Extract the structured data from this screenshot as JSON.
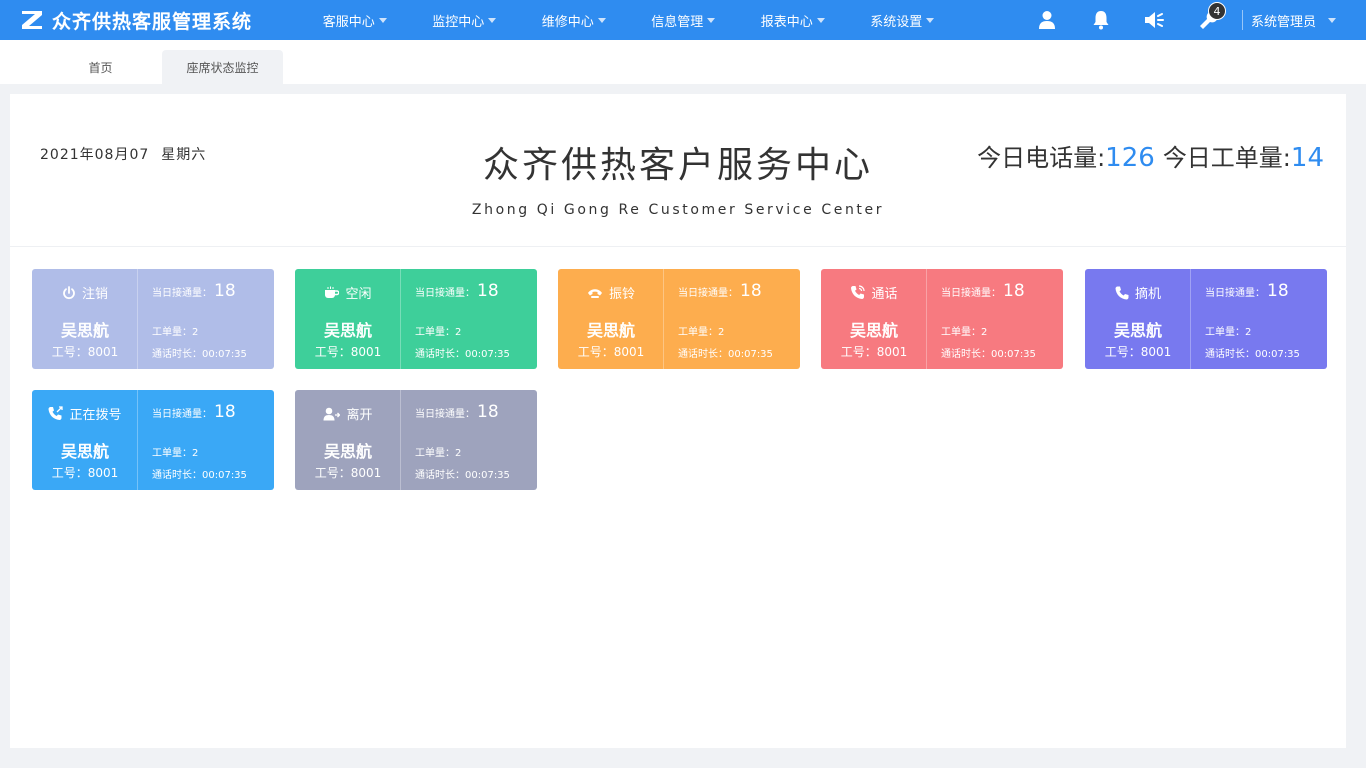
{
  "app": {
    "title": "众齐供热客服管理系统"
  },
  "nav": [
    {
      "label": "客服中心"
    },
    {
      "label": "监控中心"
    },
    {
      "label": "维修中心"
    },
    {
      "label": "信息管理"
    },
    {
      "label": "报表中心"
    },
    {
      "label": "系统设置"
    }
  ],
  "header": {
    "notification_count": "4",
    "user_name": "系统管理员"
  },
  "tabs": [
    {
      "label": "首页"
    },
    {
      "label": "座席状态监控"
    }
  ],
  "main": {
    "date": "2021年08月07",
    "weekday": "星期六",
    "title": "众齐供热客户服务中心",
    "subtitle": "Zhong Qi Gong Re Customer Service Center",
    "calls_label": "今日电话量:",
    "calls_value": "126",
    "orders_label": "今日工单量:",
    "orders_value": "14"
  },
  "colors": {
    "primary": "#2f8cf0",
    "logout": "#b0bde8",
    "idle": "#3ecf9a",
    "ringing": "#fdad4e",
    "talking": "#f77a80",
    "offhook": "#7879ef",
    "dialing": "#3aa8f6",
    "away": "#9ea3bd"
  },
  "cards": [
    {
      "status": "注销",
      "icon": "power-icon",
      "name": "吴思航",
      "id_label": "工号：8001",
      "calls_label": "当日接通量：",
      "calls": "18",
      "orders_label": "工单量：2",
      "duration_label": "通话时长：00:07:35"
    },
    {
      "status": "空闲",
      "icon": "coffee-icon",
      "name": "吴思航",
      "id_label": "工号：8001",
      "calls_label": "当日接通量：",
      "calls": "18",
      "orders_label": "工单量：2",
      "duration_label": "通话时长：00:07:35"
    },
    {
      "status": "振铃",
      "icon": "ringing-phone-icon",
      "name": "吴思航",
      "id_label": "工号：8001",
      "calls_label": "当日接通量：",
      "calls": "18",
      "orders_label": "工单量：2",
      "duration_label": "通话时长：00:07:35"
    },
    {
      "status": "通话",
      "icon": "phone-volume-icon",
      "name": "吴思航",
      "id_label": "工号：8001",
      "calls_label": "当日接通量：",
      "calls": "18",
      "orders_label": "工单量：2",
      "duration_label": "通话时长：00:07:35"
    },
    {
      "status": "摘机",
      "icon": "phone-icon",
      "name": "吴思航",
      "id_label": "工号：8001",
      "calls_label": "当日接通量：",
      "calls": "18",
      "orders_label": "工单量：2",
      "duration_label": "通话时长：00:07:35"
    },
    {
      "status": "正在拨号",
      "icon": "dialing-phone-icon",
      "name": "吴思航",
      "id_label": "工号：8001",
      "calls_label": "当日接通量：",
      "calls": "18",
      "orders_label": "工单量：2",
      "duration_label": "通话时长：00:07:35"
    },
    {
      "status": "离开",
      "icon": "user-away-icon",
      "name": "吴思航",
      "id_label": "工号：8001",
      "calls_label": "当日接通量：",
      "calls": "18",
      "orders_label": "工单量：2",
      "duration_label": "通话时长：00:07:35"
    }
  ]
}
